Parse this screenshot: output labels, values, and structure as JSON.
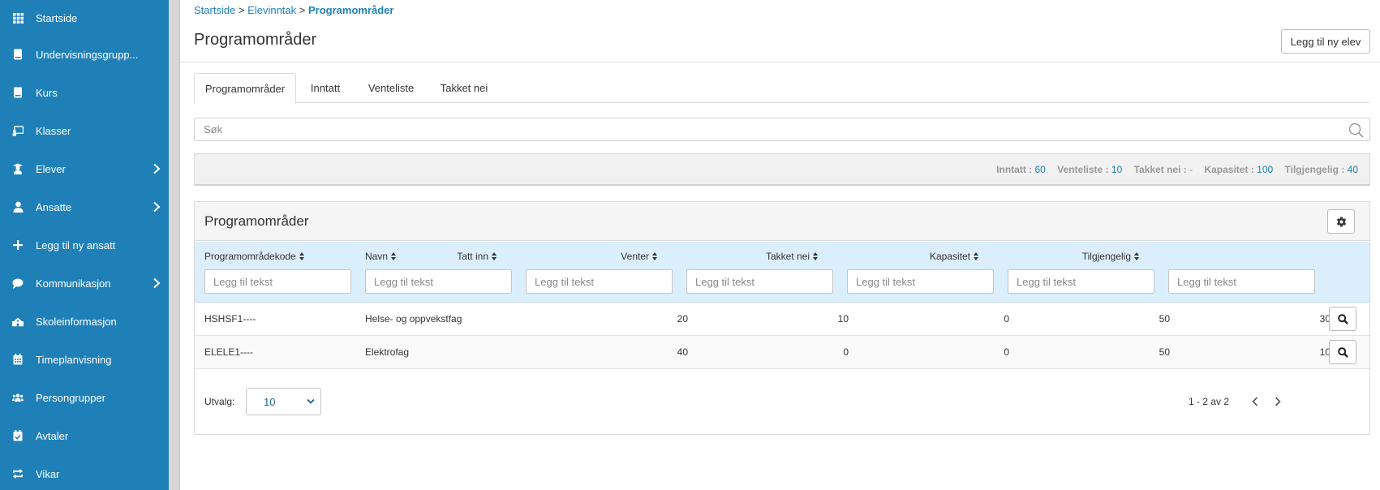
{
  "sidebar": {
    "items": [
      {
        "label": "Startside",
        "icon": "grid-icon"
      },
      {
        "label": "Undervisningsgrupp...",
        "icon": "book-icon"
      },
      {
        "label": "Kurs",
        "icon": "book-icon"
      },
      {
        "label": "Klasser",
        "icon": "presentation-icon"
      },
      {
        "label": "Elever",
        "icon": "student-icon",
        "has_children": true
      },
      {
        "label": "Ansatte",
        "icon": "user-icon",
        "has_children": true
      },
      {
        "label": "Legg til ny ansatt",
        "icon": "plus-icon"
      },
      {
        "label": "Kommunikasjon",
        "icon": "chat-icon",
        "has_children": true
      },
      {
        "label": "Skoleinformasjon",
        "icon": "school-icon"
      },
      {
        "label": "Timeplanvisning",
        "icon": "calendar-icon"
      },
      {
        "label": "Persongrupper",
        "icon": "group-icon"
      },
      {
        "label": "Avtaler",
        "icon": "calendar-check-icon"
      },
      {
        "label": "Vikar",
        "icon": "swap-icon"
      }
    ]
  },
  "breadcrumb": {
    "home": "Startside",
    "separator": ">",
    "section": "Elevinntak",
    "current": "Programområder"
  },
  "header": {
    "title": "Programområder",
    "add_button": "Legg til ny elev"
  },
  "tabs": [
    {
      "label": "Programområder",
      "active": true
    },
    {
      "label": "Inntatt",
      "active": false
    },
    {
      "label": "Venteliste",
      "active": false
    },
    {
      "label": "Takket nei",
      "active": false
    }
  ],
  "search": {
    "placeholder": "Søk",
    "value": ""
  },
  "stats": {
    "inntatt_label": "Inntatt :",
    "inntatt": "60",
    "venteliste_label": "Venteliste :",
    "venteliste": "10",
    "takket_nei_label": "Takket nei :",
    "takket_nei": "-",
    "kapasitet_label": "Kapasitet :",
    "kapasitet": "100",
    "tilgjengelig_label": "Tilgjengelig :",
    "tilgjengelig": "40"
  },
  "panel": {
    "title": "Programområder",
    "columns": [
      "Programområdekode",
      "Navn",
      "Tatt inn",
      "Venter",
      "Takket nei",
      "Kapasitet",
      "Tilgjengelig"
    ],
    "filter_placeholder": "Legg til tekst",
    "rows": [
      {
        "kode": "HSHSF1----",
        "navn": "Helse- og oppvekstfag",
        "tatt_inn": "20",
        "venter": "10",
        "takket_nei": "0",
        "kapasitet": "50",
        "tilgjengelig": "30"
      },
      {
        "kode": "ELELE1----",
        "navn": "Elektrofag",
        "tatt_inn": "40",
        "venter": "0",
        "takket_nei": "0",
        "kapasitet": "50",
        "tilgjengelig": "10"
      }
    ]
  },
  "footer": {
    "page_size_label": "Utvalg:",
    "page_size": "10",
    "pager_info": "1 - 2 av 2"
  },
  "colors": {
    "sidebar": "#1f80b8",
    "accent": "#1f80b8",
    "table_header": "#dbeefb"
  }
}
